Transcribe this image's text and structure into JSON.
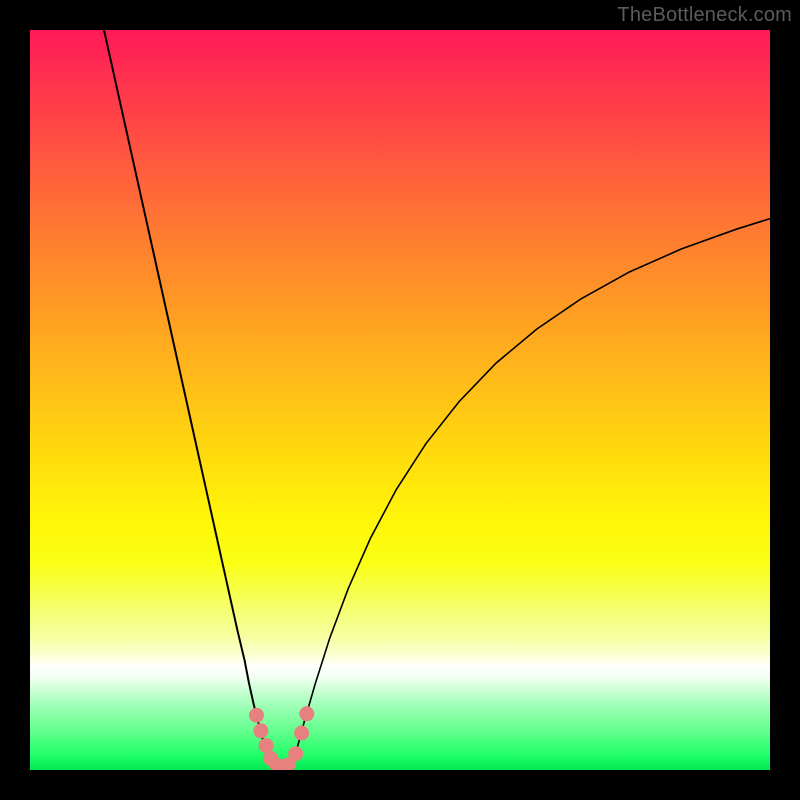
{
  "branding": "TheBottleneck.com",
  "colors": {
    "marker": "#e7817f",
    "curve": "#000000"
  },
  "chart_data": {
    "type": "line",
    "title": "",
    "xlabel": "",
    "ylabel": "",
    "xlim": [
      0,
      100
    ],
    "ylim": [
      0,
      100
    ],
    "series": [
      {
        "name": "left-branch",
        "x": [
          10,
          12,
          14,
          16,
          18,
          20,
          21,
          22,
          23,
          24,
          25,
          26,
          27,
          28,
          29,
          29.6,
          30.2,
          30.8,
          31.4,
          31.88
        ],
        "y": [
          100,
          91,
          82,
          73,
          64,
          55,
          50.5,
          46,
          41.5,
          37,
          32.5,
          28,
          23.5,
          19,
          14.8,
          11.7,
          9.0,
          6.6,
          4.4,
          2.6
        ]
      },
      {
        "name": "right-branch",
        "x": [
          36.0,
          37.0,
          38.5,
          40.5,
          43.0,
          46.0,
          49.5,
          53.5,
          58.0,
          63.0,
          68.5,
          74.5,
          81.0,
          88.0,
          95.5,
          100.0
        ],
        "y": [
          2.6,
          6.3,
          11.5,
          17.8,
          24.5,
          31.3,
          37.9,
          44.1,
          49.8,
          55.0,
          59.6,
          63.7,
          67.3,
          70.4,
          73.1,
          74.5
        ]
      },
      {
        "name": "trough",
        "x": [
          31.88,
          32.4,
          33.1,
          34.0,
          34.9,
          35.5,
          36.0
        ],
        "y": [
          2.6,
          1.2,
          0.55,
          0.4,
          0.55,
          1.3,
          2.6
        ]
      }
    ],
    "markers": [
      {
        "x": 30.6,
        "y": 7.4,
        "r": 7.5
      },
      {
        "x": 31.2,
        "y": 5.3,
        "r": 7.5
      },
      {
        "x": 31.9,
        "y": 3.3,
        "r": 7.5
      },
      {
        "x": 32.5,
        "y": 1.6,
        "r": 7.5
      },
      {
        "x": 33.2,
        "y": 0.8,
        "r": 7.0
      },
      {
        "x": 34.1,
        "y": 0.55,
        "r": 7.0
      },
      {
        "x": 35.0,
        "y": 0.8,
        "r": 7.0
      },
      {
        "x": 35.9,
        "y": 2.2,
        "r": 7.5
      },
      {
        "x": 36.7,
        "y": 5.0,
        "r": 7.5
      },
      {
        "x": 37.4,
        "y": 7.6,
        "r": 7.5
      }
    ],
    "legend": [],
    "grid": false
  }
}
